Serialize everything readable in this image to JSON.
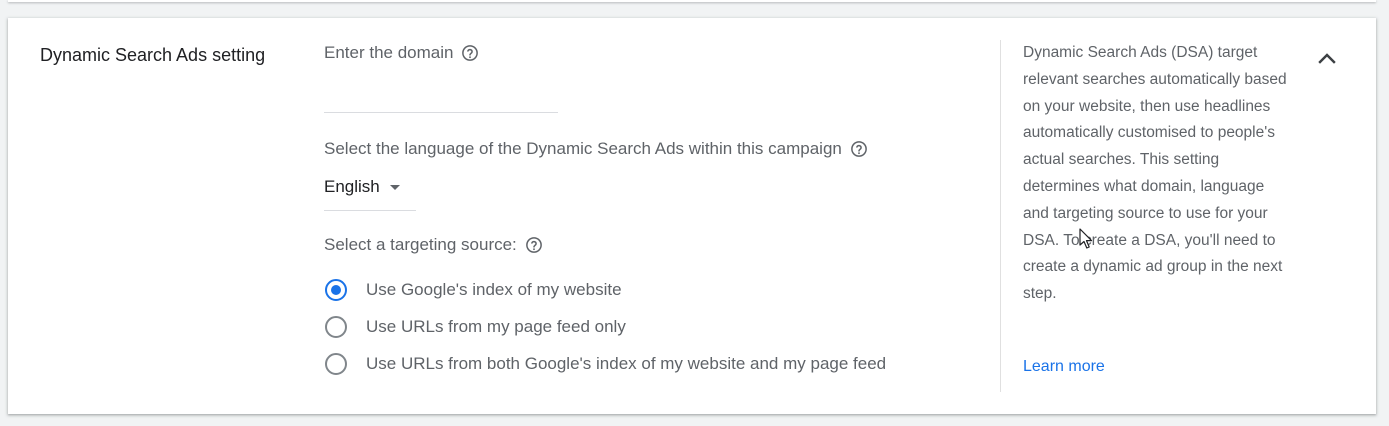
{
  "section": {
    "title": "Dynamic Search Ads setting"
  },
  "domain": {
    "label": "Enter the domain",
    "value": "",
    "help_icon": "help-circle-icon"
  },
  "language": {
    "label": "Select the language of the Dynamic Search Ads within this campaign",
    "selected": "English",
    "help_icon": "help-circle-icon"
  },
  "targeting": {
    "label": "Select a targeting source:",
    "help_icon": "help-circle-icon",
    "options": [
      {
        "label": "Use Google's index of my website",
        "checked": true
      },
      {
        "label": "Use URLs from my page feed only",
        "checked": false
      },
      {
        "label": "Use URLs from both Google's index of my website and my page feed",
        "checked": false
      }
    ]
  },
  "help_panel": {
    "text": "Dynamic Search Ads (DSA) target relevant searches automatically based on your website, then use headlines automatically customised to people's actual searches. This setting determines what domain, language and targeting source to use for your DSA. To create a DSA, you'll need to create a dynamic ad group in the next step.",
    "learn_more": "Learn more",
    "collapse_icon": "chevron-up-icon"
  },
  "colors": {
    "accent": "#1a73e8",
    "text_primary": "#202124",
    "text_secondary": "#5f6368"
  }
}
